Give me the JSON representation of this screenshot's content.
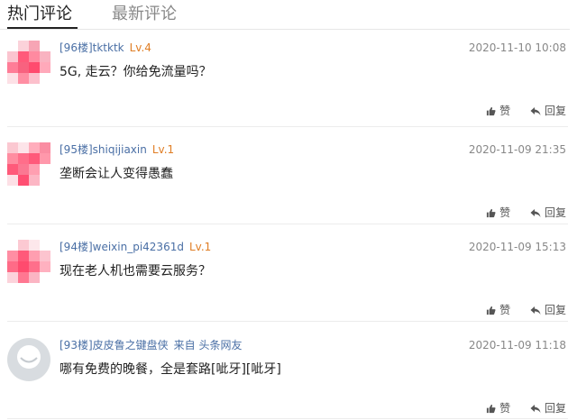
{
  "tabs": [
    {
      "label": "热门评论",
      "active": true
    },
    {
      "label": "最新评论",
      "active": false
    }
  ],
  "actions": {
    "like": "赞",
    "reply": "回复"
  },
  "comments": [
    {
      "floor": "[96楼]",
      "user": "tktktk",
      "level": "Lv.4",
      "time": "2020-11-10 10:08",
      "text": "5G, 走云？你给免流量吗？",
      "avatar": "mosaic"
    },
    {
      "floor": "[95楼]",
      "user": "shiqijiaxin",
      "level": "Lv.1",
      "time": "2020-11-09 21:35",
      "text": "垄断会让人变得愚蠢",
      "avatar": "mosaic"
    },
    {
      "floor": "[94楼]",
      "user": "weixin_pi42361d",
      "level": "Lv.1",
      "time": "2020-11-09 15:13",
      "text": "现在老人机也需要云服务？",
      "avatar": "mosaic"
    },
    {
      "floor": "[93楼]",
      "user": "皮皮鲁之键盘侠",
      "source": "来自 头条网友",
      "time": "2020-11-09 11:18",
      "text": "哪有免费的晚餐，全是套路[呲牙][呲牙]",
      "avatar": "default"
    }
  ],
  "colors": {
    "user_link": "#4a6fa5",
    "level": "#e07e25",
    "timestamp": "#888888",
    "avatar_pink": "#ff5a7a"
  },
  "icons": {
    "like": "thumbs-up-icon",
    "reply": "reply-arrow-icon"
  }
}
